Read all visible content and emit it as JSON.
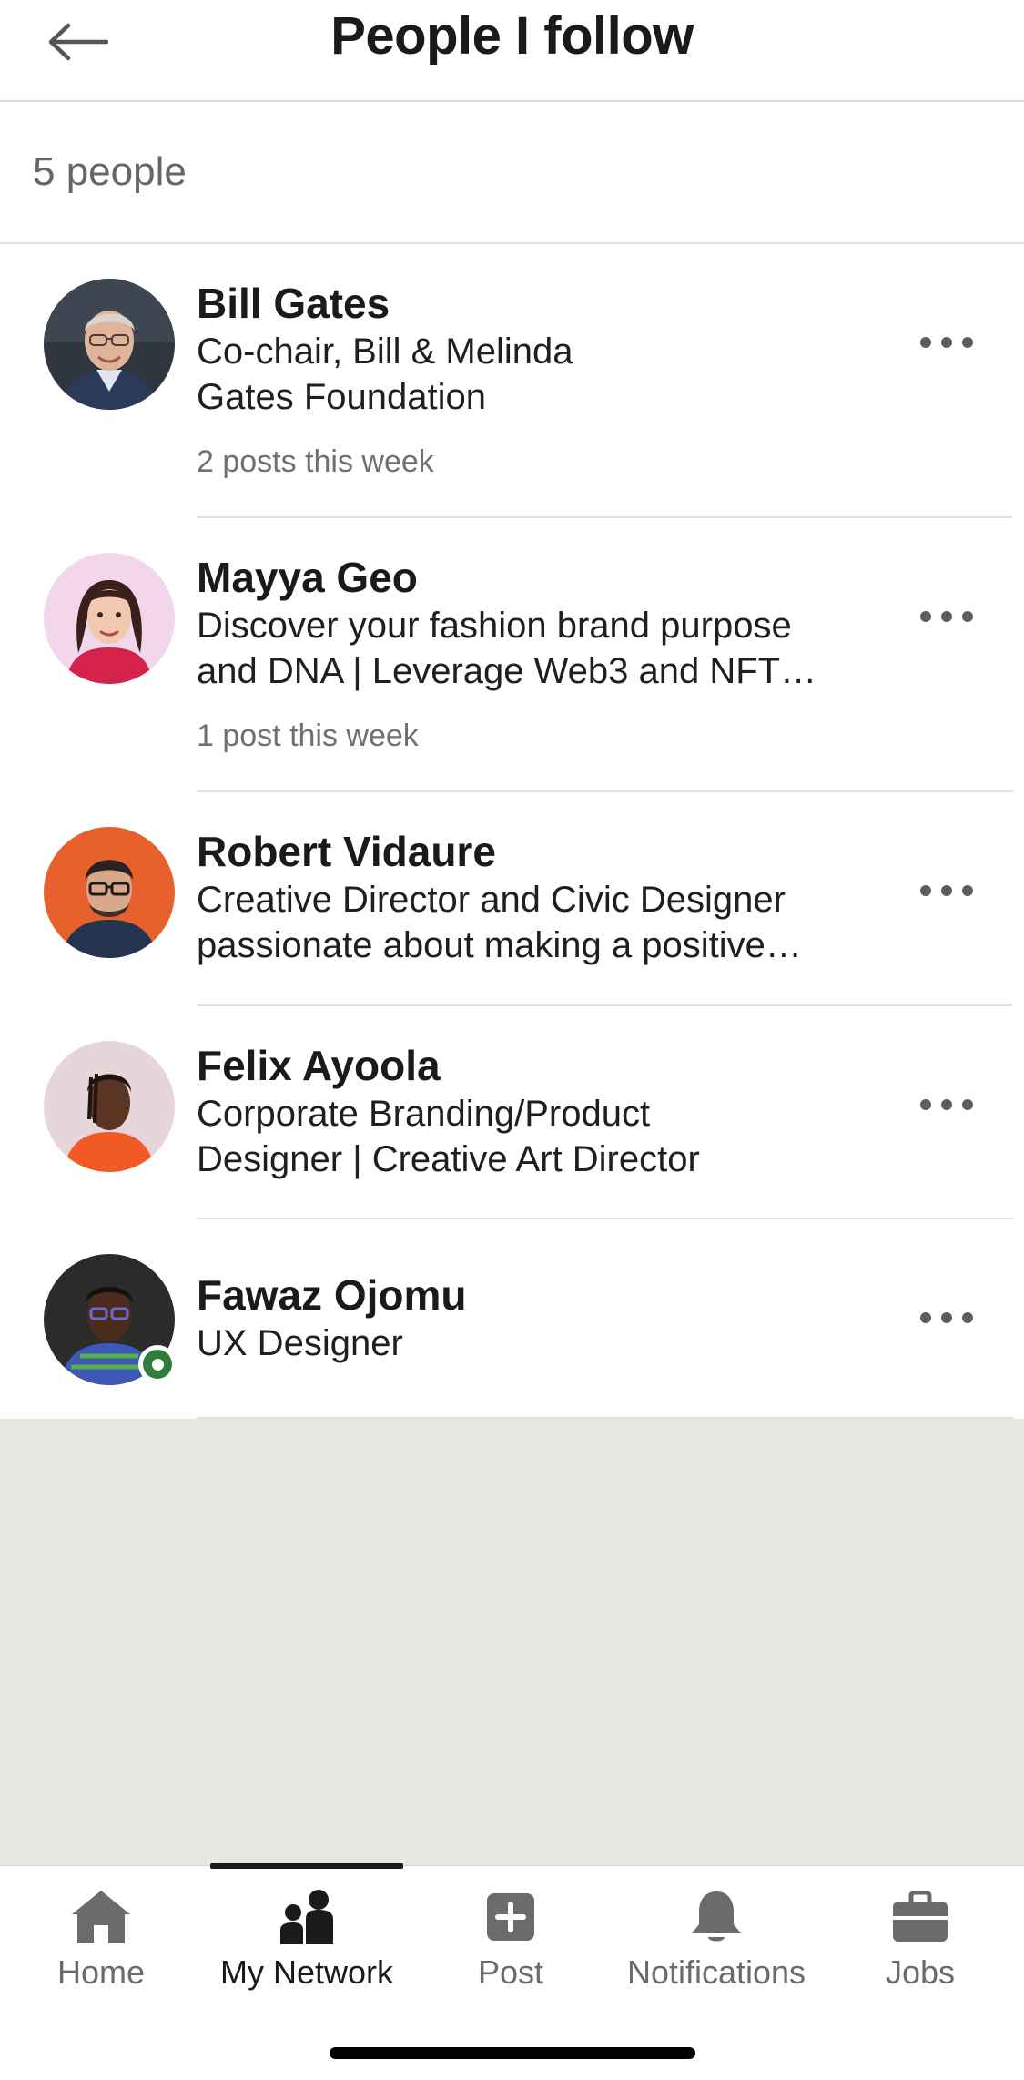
{
  "header": {
    "title": "People I follow",
    "back_icon": "arrow-left-icon"
  },
  "summary": {
    "count_text": "5 people"
  },
  "people": [
    {
      "name": "Bill Gates",
      "headline_lines": [
        "Co-chair, Bill & Melinda",
        "Gates Foundation"
      ],
      "activity": "2 posts this week",
      "online": false
    },
    {
      "name": "Mayya Geo",
      "headline_lines": [
        "Discover your fashion brand purpose",
        "and DNA | Leverage Web3 and NFT…"
      ],
      "activity": "1 post this week",
      "online": false
    },
    {
      "name": "Robert Vidaure",
      "headline_lines": [
        "Creative Director and Civic Designer",
        "passionate about making a positive…"
      ],
      "activity": "",
      "online": false
    },
    {
      "name": "Felix Ayoola",
      "headline_lines": [
        "Corporate Branding/Product",
        "Designer | Creative Art Director"
      ],
      "activity": "",
      "online": false
    },
    {
      "name": "Fawaz Ojomu",
      "headline_lines": [
        "UX Designer"
      ],
      "activity": "",
      "online": true
    }
  ],
  "bottom_nav": {
    "items": [
      {
        "label": "Home",
        "icon": "home-icon",
        "active": false
      },
      {
        "label": "My Network",
        "icon": "network-icon",
        "active": true
      },
      {
        "label": "Post",
        "icon": "plus-square-icon",
        "active": false
      },
      {
        "label": "Notifications",
        "icon": "bell-icon",
        "active": false
      },
      {
        "label": "Jobs",
        "icon": "briefcase-icon",
        "active": false
      }
    ]
  },
  "colors": {
    "text_primary": "#1a1a1a",
    "text_secondary": "#666666",
    "divider": "#e1e1e1",
    "empty_background": "#e8e6e0",
    "online_green": "#2f7d3c",
    "nav_inactive": "#6b6b6b"
  }
}
